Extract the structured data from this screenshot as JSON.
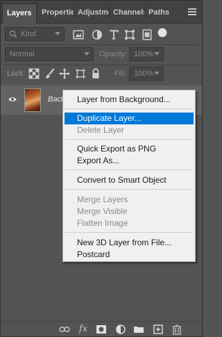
{
  "tabs": [
    {
      "label": "Layers"
    },
    {
      "label": "Propertie"
    },
    {
      "label": "Adjustme"
    },
    {
      "label": "Channels"
    },
    {
      "label": "Paths"
    }
  ],
  "filter": {
    "kind_label": "Kind"
  },
  "blend": {
    "mode": "Normal",
    "opacity_label": "Opacity:",
    "opacity_value": "100%"
  },
  "lock": {
    "label": "Lock:",
    "fill_label": "Fill:",
    "fill_value": "100%"
  },
  "layer": {
    "name": "Back"
  },
  "context_menu": {
    "items": [
      {
        "label": "Layer from Background...",
        "enabled": true
      },
      {
        "label": "Duplicate Layer...",
        "enabled": true,
        "highlighted": true
      },
      {
        "label": "Delete Layer",
        "enabled": false
      },
      {
        "label": "Quick Export as PNG",
        "enabled": true
      },
      {
        "label": "Export As...",
        "enabled": true
      },
      {
        "label": "Convert to Smart Object",
        "enabled": true
      },
      {
        "label": "Merge Layers",
        "enabled": false
      },
      {
        "label": "Merge Visible",
        "enabled": false
      },
      {
        "label": "Flatten Image",
        "enabled": false
      },
      {
        "label": "New 3D Layer from File...",
        "enabled": true
      },
      {
        "label": "Postcard",
        "enabled": true
      }
    ]
  },
  "bottom_icons": [
    {
      "name": "link-icon",
      "glyph": "⊖"
    },
    {
      "name": "fx-icon",
      "glyph": "fx"
    },
    {
      "name": "mask-icon",
      "glyph": "◙"
    },
    {
      "name": "adjustment-icon",
      "glyph": "◐"
    },
    {
      "name": "folder-icon",
      "glyph": "▬"
    },
    {
      "name": "new-layer-icon",
      "glyph": "⊞"
    },
    {
      "name": "trash-icon",
      "glyph": "🗑"
    }
  ],
  "colors": {
    "highlight": "#0078d7",
    "panel": "#535353",
    "tabbar": "#424242"
  }
}
